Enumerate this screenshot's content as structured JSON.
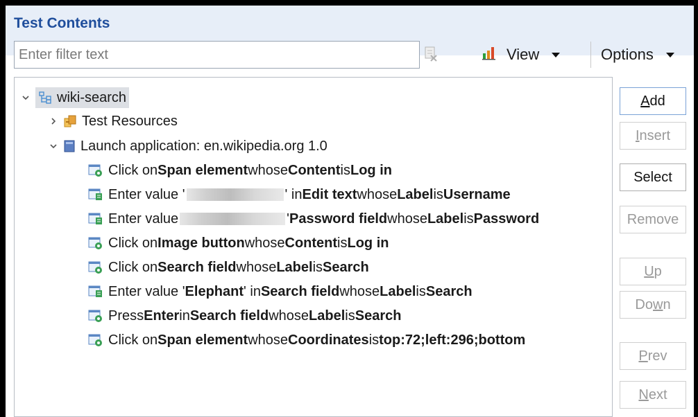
{
  "panel": {
    "title": "Test Contents"
  },
  "filter": {
    "placeholder": "Enter filter text",
    "value": ""
  },
  "toolbar": {
    "view_label": "View",
    "options_label": "Options"
  },
  "tree": {
    "root": {
      "label": "wiki-search",
      "expanded": true,
      "selected": true
    },
    "resources": {
      "label": "Test Resources",
      "expanded": false
    },
    "launch": {
      "label": "Launch application: en.wikipedia.org  1.0",
      "expanded": true
    },
    "steps": [
      {
        "icon": "click-step-icon",
        "parts": [
          "Click on ",
          "Span element",
          " whose ",
          "Content",
          " is ",
          "Log in"
        ]
      },
      {
        "icon": "enter-step-icon",
        "parts": [
          "Enter value '",
          "",
          "' in ",
          "Edit text",
          " whose ",
          "Label",
          " is ",
          "Username"
        ],
        "masked": true
      },
      {
        "icon": "enter-step-icon",
        "parts": [
          "Enter value ",
          "",
          "' ",
          "Password field",
          " whose ",
          "Label",
          " is ",
          "Password"
        ],
        "masked": true
      },
      {
        "icon": "click-step-icon",
        "parts": [
          "Click on ",
          "Image button",
          " whose ",
          "Content",
          " is ",
          "Log in"
        ]
      },
      {
        "icon": "click-step-icon",
        "parts": [
          "Click on ",
          "Search field",
          " whose ",
          "Label",
          " is ",
          "Search"
        ]
      },
      {
        "icon": "enter-step-icon",
        "parts": [
          "Enter value '",
          "Elephant",
          "' in ",
          "Search field",
          " whose ",
          "Label",
          " is ",
          "Search"
        ]
      },
      {
        "icon": "click-step-icon",
        "parts": [
          "Press ",
          "Enter",
          " in ",
          "Search field",
          " whose ",
          "Label",
          " is ",
          "Search"
        ]
      },
      {
        "icon": "click-step-icon",
        "parts": [
          "Click on ",
          "Span element",
          " whose ",
          "Coordinates",
          " is ",
          "top:72;left:296;bottom"
        ]
      }
    ]
  },
  "buttons": {
    "add": {
      "label": "Add",
      "mnemonic": "A",
      "rest": "dd",
      "enabled": true
    },
    "insert": {
      "label": "Insert",
      "mnemonic": "I",
      "rest": "nsert",
      "enabled": false
    },
    "select": {
      "label": "Select",
      "enabled": true
    },
    "remove": {
      "label": "Remove",
      "enabled": false
    },
    "up": {
      "label": "Up",
      "mnemonic": "U",
      "rest": "p",
      "enabled": false
    },
    "down": {
      "label": "Down",
      "pre": "Do",
      "mnemonic": "w",
      "rest": "n",
      "enabled": false
    },
    "prev": {
      "label": "Prev",
      "mnemonic": "P",
      "rest": "rev",
      "enabled": false
    },
    "next": {
      "label": "Next",
      "mnemonic": "N",
      "rest": "ext",
      "enabled": false
    }
  },
  "colors": {
    "title": "#1f4e9c",
    "header_bg": "#e7eef8",
    "disabled_text": "#9a9a9a",
    "selection_bg": "#dcdfe4"
  }
}
